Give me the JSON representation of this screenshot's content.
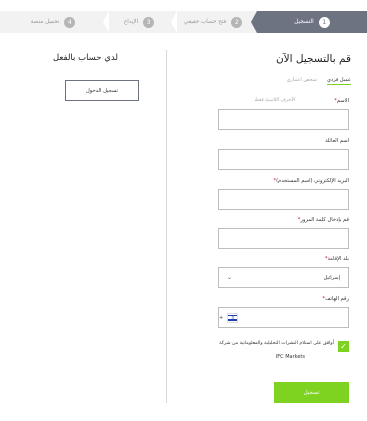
{
  "steps": [
    {
      "number": "1",
      "label": "التسجيل",
      "active": true
    },
    {
      "number": "2",
      "label": "فتح حساب حقيقي",
      "active": false
    },
    {
      "number": "3",
      "label": "الإيداع",
      "active": false
    },
    {
      "number": "4",
      "label": "تحميل منصة",
      "active": false
    }
  ],
  "register": {
    "title": "قم بالتسجيل الآن",
    "type_personal": "عميل فردي",
    "type_corporate": "شخص اعتباري",
    "name_label": "الاسم",
    "name_hint": "الأحرف اللاتينية فقط",
    "surname_label": "اسم العائلة",
    "email_label": "البريد الإلكتروني (اسم المستخدم)",
    "password_label": "قم بإدخال كلمة المرور",
    "country_label": "بلد الإقامة",
    "country_value": "إسرائيل",
    "phone_label": "رقم الهاتف",
    "phone_prefix": "+",
    "consent_text": "أوافق على استلام النشرات التحليلية والمعلوماتية من شركة",
    "consent_brand": "IFC Markets",
    "submit_label": "تسجيل"
  },
  "login": {
    "title": "لدي حساب بالفعل",
    "button_label": "تسجيل الدخول"
  },
  "colors": {
    "accent": "#7ed321",
    "step_active": "#6e7381",
    "required": "#d0021b"
  },
  "icons": {
    "dropdown": "chevron-down-icon",
    "flag": "israel-flag-icon",
    "check": "check-icon"
  }
}
